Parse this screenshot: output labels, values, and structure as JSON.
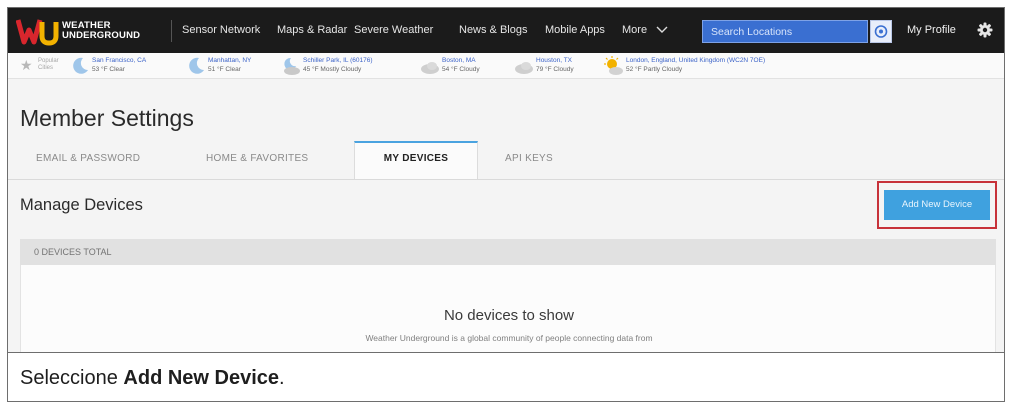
{
  "brand": {
    "line1": "WEATHER",
    "line2": "UNDERGROUND"
  },
  "nav": [
    "Sensor Network",
    "Maps & Radar",
    "Severe Weather",
    "News & Blogs",
    "Mobile Apps",
    "More"
  ],
  "search": {
    "placeholder": "Search Locations"
  },
  "profile_label": "My Profile",
  "popular": {
    "label_line1": "Popular",
    "label_line2": "Cities"
  },
  "cities": [
    {
      "name": "San Francisco, CA",
      "temp": "53 °F Clear",
      "icon": "moon-icon"
    },
    {
      "name": "Manhattan, NY",
      "temp": "51 °F Clear",
      "icon": "moon-icon"
    },
    {
      "name": "Schiller Park, IL (60176)",
      "temp": "45 °F Mostly Cloudy",
      "icon": "moon-cloud-icon"
    },
    {
      "name": "Boston, MA",
      "temp": "54 °F Cloudy",
      "icon": "cloud-icon"
    },
    {
      "name": "Houston, TX",
      "temp": "79 °F Cloudy",
      "icon": "cloud-icon"
    },
    {
      "name": "London, England, United Kingdom (WC2N 7OE)",
      "temp": "52 °F Partly Cloudy",
      "icon": "sun-cloud-icon"
    }
  ],
  "page_title": "Member Settings",
  "tabs": [
    "EMAIL & PASSWORD",
    "HOME & FAVORITES",
    "MY DEVICES",
    "API KEYS"
  ],
  "active_tab": "MY DEVICES",
  "section_title": "Manage Devices",
  "add_button": "Add New Device",
  "devices_total": "0 DEVICES TOTAL",
  "empty_title": "No devices to show",
  "empty_sub": "Weather Underground is a global community of people connecting data from",
  "caption": {
    "prefix": "Seleccione ",
    "bold": "Add New Device",
    "suffix": "."
  },
  "colors": {
    "nav_bg": "#1b1b1b",
    "accent_blue": "#3fa1df",
    "highlight_red": "#c7323a",
    "logo_red": "#d9262d",
    "logo_yellow": "#f2b200"
  }
}
